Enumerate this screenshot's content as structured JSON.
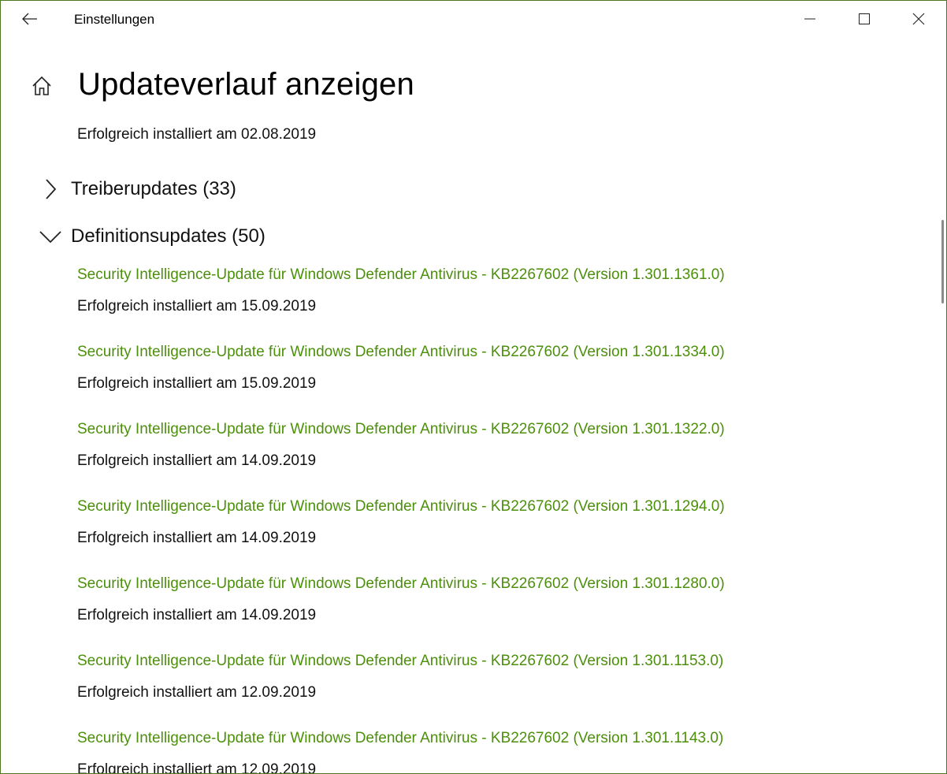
{
  "window": {
    "title": "Einstellungen",
    "accent_color": "#4a7a1f"
  },
  "titlebar": {
    "back_icon": "back-arrow-icon",
    "minimize_icon": "minimize-icon",
    "maximize_icon": "maximize-icon",
    "close_icon": "close-icon"
  },
  "header": {
    "home_icon": "home-icon",
    "title": "Updateverlauf anzeigen",
    "previous_item_status": "Erfolgreich installiert am 02.08.2019"
  },
  "categories": [
    {
      "label": "Treiberupdates (33)",
      "expanded": false,
      "icon": "chevron-right-icon"
    },
    {
      "label": "Definitionsupdates (50)",
      "expanded": true,
      "icon": "chevron-down-icon"
    }
  ],
  "link_color": "#4c8f0b",
  "updates": [
    {
      "title": "Security Intelligence-Update für Windows Defender Antivirus - KB2267602 (Version 1.301.1361.0)",
      "status": "Erfolgreich installiert am 15.09.2019"
    },
    {
      "title": "Security Intelligence-Update für Windows Defender Antivirus - KB2267602 (Version 1.301.1334.0)",
      "status": "Erfolgreich installiert am 15.09.2019"
    },
    {
      "title": "Security Intelligence-Update für Windows Defender Antivirus - KB2267602 (Version 1.301.1322.0)",
      "status": "Erfolgreich installiert am 14.09.2019"
    },
    {
      "title": "Security Intelligence-Update für Windows Defender Antivirus - KB2267602 (Version 1.301.1294.0)",
      "status": "Erfolgreich installiert am 14.09.2019"
    },
    {
      "title": "Security Intelligence-Update für Windows Defender Antivirus - KB2267602 (Version 1.301.1280.0)",
      "status": "Erfolgreich installiert am 14.09.2019"
    },
    {
      "title": "Security Intelligence-Update für Windows Defender Antivirus - KB2267602 (Version 1.301.1153.0)",
      "status": "Erfolgreich installiert am 12.09.2019"
    },
    {
      "title": "Security Intelligence-Update für Windows Defender Antivirus - KB2267602 (Version 1.301.1143.0)",
      "status": "Erfolgreich installiert am 12.09.2019"
    }
  ]
}
